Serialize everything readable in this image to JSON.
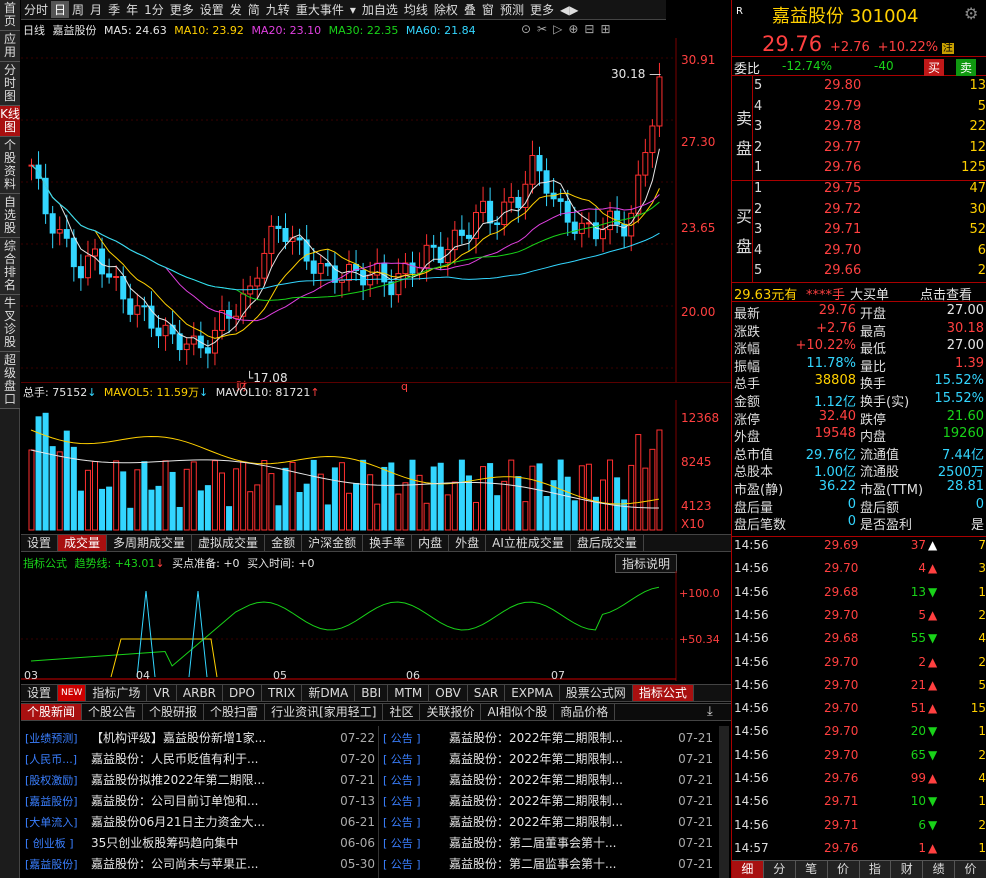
{
  "left_nav": [
    "首页",
    "应用",
    "分时图",
    "K线图",
    "个股资料",
    "自选股",
    "综合排名",
    "牛叉诊股",
    "超级盘口"
  ],
  "left_nav_active": 3,
  "toolbar": [
    "分时",
    "日",
    "周",
    "月",
    "季",
    "年",
    "1分",
    "更多",
    "设置",
    "发",
    "简",
    "九转",
    "重大事件",
    "▾",
    "加自选",
    "均线",
    "除权",
    "叠",
    "窗",
    "预测",
    "更多",
    "◀▶"
  ],
  "toolbar_selected": 1,
  "stock": {
    "name": "嘉益股份",
    "code": "301004",
    "price": "29.76",
    "change": "+2.76",
    "pct": "+10.22%",
    "tag": "注",
    "r_icon": "R"
  },
  "kline_legend": {
    "period": "日线",
    "name": "嘉益股份",
    "ma5": "MA5: 24.63",
    "ma10": "MA10: 23.92",
    "ma20": "MA20: 23.10",
    "ma30": "MA30: 22.35",
    "ma60": "MA60: 21.84"
  },
  "price_axis": [
    "30.91",
    "27.30",
    "23.65",
    "20.00"
  ],
  "kline_marks": {
    "high": "30.18",
    "low": "17.08",
    "cai": "财",
    "q": "q"
  },
  "vol_legend": {
    "total": "总手: 75152",
    "mavol5": "MAVOL5: 11.59万",
    "mavol10": "MAVOL10: 81721"
  },
  "vol_axis": [
    "12368",
    "8245",
    "4123",
    "X10"
  ],
  "vol_tabs": [
    "设置",
    "成交量",
    "多周期成交量",
    "虚拟成交量",
    "金额",
    "沪深金额",
    "换手率",
    "内盘",
    "外盘",
    "AI立桩成交量",
    "盘后成交量"
  ],
  "vol_tab_selected": 1,
  "ind_legend": {
    "name": "指标公式",
    "trend": "趋势线: +43.01",
    "buy": "买点准备: +0",
    "time": "买入时间: +0",
    "explain": "指标说明"
  },
  "ind_axis": [
    "+100.0",
    "+50.34"
  ],
  "months": [
    "03",
    "04",
    "05",
    "06",
    "07"
  ],
  "bottom_tabs": [
    "设置",
    "NEW",
    "指标广场",
    "VR",
    "ARBR",
    "DPO",
    "TRIX",
    "新DMA",
    "BBI",
    "MTM",
    "OBV",
    "SAR",
    "EXPMA",
    "股票公式网",
    "指标公式"
  ],
  "bottom_tab_selected": 14,
  "news_tabs": [
    "个股新闻",
    "个股公告",
    "个股研报",
    "个股扫雷",
    "行业资讯[家用轻工]",
    "社区",
    "关联报价",
    "AI相似个股",
    "商品价格"
  ],
  "news_left": [
    {
      "tag": "[业绩预测]",
      "title": "【机构评级】嘉益股份新增1家...",
      "date": "07-22"
    },
    {
      "tag": "[人民币...]",
      "title": "嘉益股份：人民币贬值有利于...",
      "date": "07-20"
    },
    {
      "tag": "[股权激励]",
      "title": "嘉益股份拟推2022年第二期限...",
      "date": "07-21"
    },
    {
      "tag": "[嘉益股份]",
      "title": "嘉益股份：公司目前订单饱和...",
      "date": "07-13"
    },
    {
      "tag": "[大单流入]",
      "title": "嘉益股份06月21日主力资金大...",
      "date": "06-21"
    },
    {
      "tag": "[ 创业板 ]",
      "title": "35只创业板股筹码趋向集中",
      "date": "06-06"
    },
    {
      "tag": "[嘉益股份]",
      "title": "嘉益股份：公司尚未与苹果正...",
      "date": "05-30"
    }
  ],
  "news_right": [
    {
      "tag": "[  公告  ]",
      "title": "嘉益股份：2022年第二期限制...",
      "date": "07-21"
    },
    {
      "tag": "[  公告  ]",
      "title": "嘉益股份：2022年第二期限制...",
      "date": "07-21"
    },
    {
      "tag": "[  公告  ]",
      "title": "嘉益股份：2022年第二期限制...",
      "date": "07-21"
    },
    {
      "tag": "[  公告  ]",
      "title": "嘉益股份：2022年第二期限制...",
      "date": "07-21"
    },
    {
      "tag": "[  公告  ]",
      "title": "嘉益股份：2022年第二期限制...",
      "date": "07-21"
    },
    {
      "tag": "[  公告  ]",
      "title": "嘉益股份：第二届董事会第十...",
      "date": "07-21"
    },
    {
      "tag": "[  公告  ]",
      "title": "嘉益股份：第二届监事会第十...",
      "date": "07-21"
    }
  ],
  "weibi": {
    "label": "委比",
    "pct": "-12.74%",
    "diff": "-40",
    "buy": "买",
    "sell": "卖"
  },
  "sell_orders": [
    [
      "5",
      "29.80",
      "13"
    ],
    [
      "4",
      "29.79",
      "5"
    ],
    [
      "3",
      "29.78",
      "22"
    ],
    [
      "2",
      "29.77",
      "12"
    ],
    [
      "1",
      "29.76",
      "125"
    ]
  ],
  "buy_orders": [
    [
      "1",
      "29.75",
      "47"
    ],
    [
      "2",
      "29.72",
      "30"
    ],
    [
      "3",
      "29.71",
      "52"
    ],
    [
      "4",
      "29.70",
      "6"
    ],
    [
      "5",
      "29.66",
      "2"
    ]
  ],
  "sell_label": [
    "卖",
    "盘"
  ],
  "buy_label": [
    "买",
    "盘"
  ],
  "big_order": {
    "price": "29.63元有",
    "qty": "****手",
    "label": "大买单",
    "link": "点击查看"
  },
  "quote": [
    [
      "最新",
      "29.76",
      "开盘",
      "27.00"
    ],
    [
      "涨跌",
      "+2.76",
      "最高",
      "30.18"
    ],
    [
      "涨幅",
      "+10.22%",
      "最低",
      "27.00"
    ],
    [
      "振幅",
      "11.78%",
      "量比",
      "1.39"
    ],
    [
      "总手",
      "38808",
      "换手",
      "15.52%"
    ],
    [
      "金额",
      "1.12亿",
      "换手(实)",
      "15.52%"
    ],
    [
      "涨停",
      "32.40",
      "跌停",
      "21.60"
    ],
    [
      "外盘",
      "19548",
      "内盘",
      "19260"
    ],
    [
      "总市值",
      "29.76亿",
      "流通值",
      "7.44亿"
    ],
    [
      "总股本",
      "1.00亿",
      "流通股",
      "2500万"
    ],
    [
      "市盈(静)",
      "36.22",
      "市盈(TTM)",
      "28.81"
    ],
    [
      "盘后量",
      "0",
      "盘后额",
      "0"
    ],
    [
      "盘后笔数",
      "0",
      "是否盈利",
      "是"
    ]
  ],
  "ticks": [
    [
      "14:56",
      "29.69",
      "37",
      "up",
      "7"
    ],
    [
      "14:56",
      "29.70",
      "4",
      "up",
      "3"
    ],
    [
      "14:56",
      "29.68",
      "13",
      "down",
      "1"
    ],
    [
      "14:56",
      "29.70",
      "5",
      "up",
      "2"
    ],
    [
      "14:56",
      "29.68",
      "55",
      "down",
      "4"
    ],
    [
      "14:56",
      "29.70",
      "2",
      "up",
      "2"
    ],
    [
      "14:56",
      "29.70",
      "21",
      "up",
      "5"
    ],
    [
      "14:56",
      "29.70",
      "51",
      "up",
      "15"
    ],
    [
      "14:56",
      "29.70",
      "20",
      "down",
      "1"
    ],
    [
      "14:56",
      "29.70",
      "65",
      "down",
      "2"
    ],
    [
      "14:56",
      "29.76",
      "99",
      "up",
      "4"
    ],
    [
      "14:56",
      "29.71",
      "10",
      "down",
      "1"
    ],
    [
      "14:56",
      "29.71",
      "6",
      "down",
      "2"
    ],
    [
      "14:57",
      "29.76",
      "1",
      "up",
      "1"
    ]
  ],
  "bottom_right_tabs": [
    "细",
    "分",
    "笔",
    "价",
    "指",
    "财",
    "绩",
    "价"
  ],
  "colors": {
    "red": "#ff4040",
    "green": "#19d319",
    "cyan": "#33d6ff",
    "yellow": "#ffd000"
  }
}
